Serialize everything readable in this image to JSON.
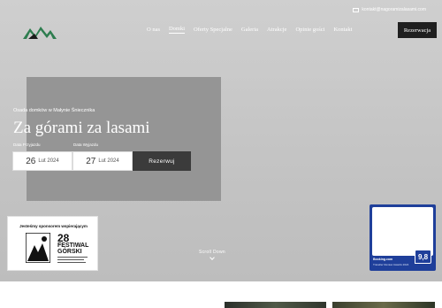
{
  "header": {
    "contact_email": "kontakt@nagoramizalasami.com",
    "nav": [
      "O nas",
      "Domki",
      "Oferty Specjalne",
      "Galeria",
      "Atrakcje",
      "Opinie gości",
      "Kontakt"
    ],
    "active_nav": "Domki",
    "book_button": "Rezerwacja"
  },
  "hero": {
    "subtitle": "Osada domków w Małynie Śniecznika",
    "title": "Za górami za lasami",
    "arrival_label": "Data Przyjazdu",
    "arrival_day": "26",
    "arrival_month": "Lut 2024",
    "departure_label": "Data Wyjazdu",
    "departure_day": "27",
    "departure_month": "Lut 2024",
    "submit_label": "Rezerwuj",
    "scroll_label": "Scroll Down"
  },
  "sponsor": {
    "text": "Jesteśmy sponsorem wspierającym",
    "number": "28",
    "line1": "FESTIWAL",
    "line2": "GÓRSKI"
  },
  "badge": {
    "score": "9,8",
    "brand": "Booking.com",
    "award": "Traveller Review Awards 2024"
  },
  "colors": {
    "nav_dark": "#1f1f1f",
    "badge_blue": "#1f3f9a",
    "hero_bg": "#c4c4c4"
  }
}
